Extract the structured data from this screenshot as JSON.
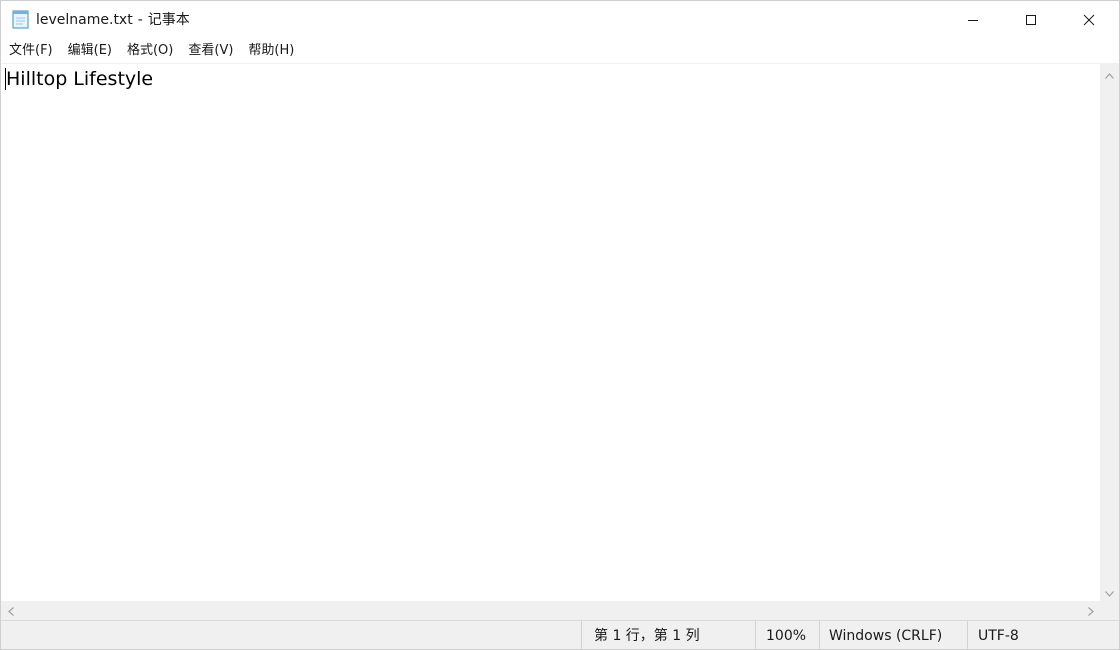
{
  "window": {
    "file_name": "levelname.txt",
    "separator": "-",
    "app_name": "记事本",
    "app_icon": "notepad-icon"
  },
  "window_controls": {
    "minimize_icon": "minimize-icon",
    "maximize_icon": "maximize-icon",
    "close_icon": "close-icon"
  },
  "menu": {
    "items": [
      {
        "label": "文件(F)"
      },
      {
        "label": "编辑(E)"
      },
      {
        "label": "格式(O)"
      },
      {
        "label": "查看(V)"
      },
      {
        "label": "帮助(H)"
      }
    ]
  },
  "editor": {
    "content": "Hilltop Lifestyle"
  },
  "status": {
    "position": "第 1 行，第 1 列",
    "zoom": "100%",
    "line_ending": "Windows (CRLF)",
    "encoding": "UTF-8"
  },
  "colors": {
    "background": "#ffffff",
    "statusbar": "#f0f0f0",
    "scrollbar": "#f0f0f0",
    "text": "#000000"
  }
}
